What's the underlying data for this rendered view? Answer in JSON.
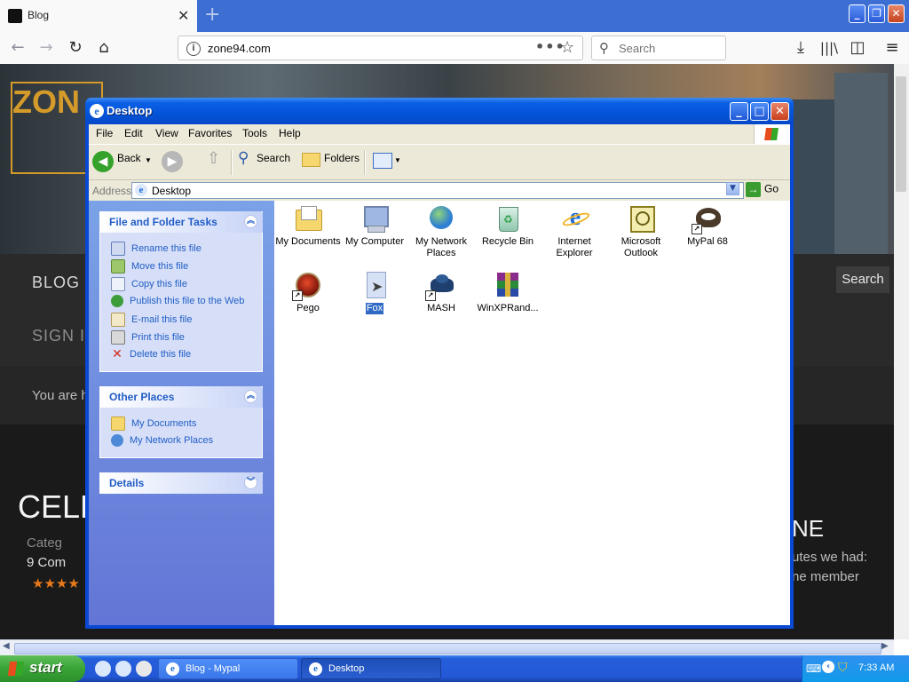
{
  "browser": {
    "tab_title": "Blog",
    "tab_close": "✕",
    "new_tab": "+",
    "url": "zone94.com",
    "search_placeholder": "Search",
    "page_actions": "•••"
  },
  "website": {
    "logo_text": "ZON",
    "nav_blog": "BLOG",
    "nav_signin": "SIGN I",
    "search_button": "Search",
    "breadcrumb": "You are h",
    "article_title_left": "CELLO",
    "category": "Categ",
    "comments": "9 Com",
    "stars": "★★★★",
    "article_title_right": "NE",
    "snippet_1": "utes we had:",
    "snippet_2": "ne member"
  },
  "explorer": {
    "title": "Desktop",
    "menu": [
      "File",
      "Edit",
      "View",
      "Favorites",
      "Tools",
      "Help"
    ],
    "toolbar": {
      "back": "Back",
      "search": "Search",
      "folders": "Folders"
    },
    "address": {
      "label": "Address",
      "value": "Desktop",
      "go": "Go"
    },
    "tasks_panel": {
      "title": "File and Folder Tasks",
      "items": [
        {
          "label": "Rename this file",
          "icon": "rename-icon"
        },
        {
          "label": "Move this file",
          "icon": "move-icon"
        },
        {
          "label": "Copy this file",
          "icon": "copy-icon"
        },
        {
          "label": "Publish this file to the Web",
          "icon": "publish-icon"
        },
        {
          "label": "E-mail this file",
          "icon": "email-icon"
        },
        {
          "label": "Print this file",
          "icon": "print-icon"
        },
        {
          "label": "Delete this file",
          "icon": "delete-icon"
        }
      ]
    },
    "places_panel": {
      "title": "Other Places",
      "items": [
        {
          "label": "My Documents",
          "icon": "my-documents-icon"
        },
        {
          "label": "My Network Places",
          "icon": "network-places-icon"
        }
      ]
    },
    "details_panel": {
      "title": "Details"
    },
    "desktop_items": [
      {
        "label": "My Documents",
        "icon": "my-documents-icon"
      },
      {
        "label": "My Computer",
        "icon": "my-computer-icon"
      },
      {
        "label": "My Network Places",
        "icon": "network-places-icon"
      },
      {
        "label": "Recycle Bin",
        "icon": "recycle-bin-icon"
      },
      {
        "label": "Internet Explorer",
        "icon": "internet-explorer-icon"
      },
      {
        "label": "Microsoft Outlook",
        "icon": "outlook-icon"
      },
      {
        "label": "MyPal 68",
        "icon": "mypal-icon"
      },
      {
        "label": "Pego",
        "icon": "pego-icon"
      },
      {
        "label": "Fox",
        "icon": "fox-file-icon",
        "selected": true
      },
      {
        "label": "MASH",
        "icon": "mash-icon"
      },
      {
        "label": "WinXPRand...",
        "icon": "winrar-archive-icon"
      }
    ]
  },
  "taskbar": {
    "start": "start",
    "tasks": [
      "Blog - Mypal",
      "Desktop"
    ],
    "clock": "7:33 AM"
  }
}
